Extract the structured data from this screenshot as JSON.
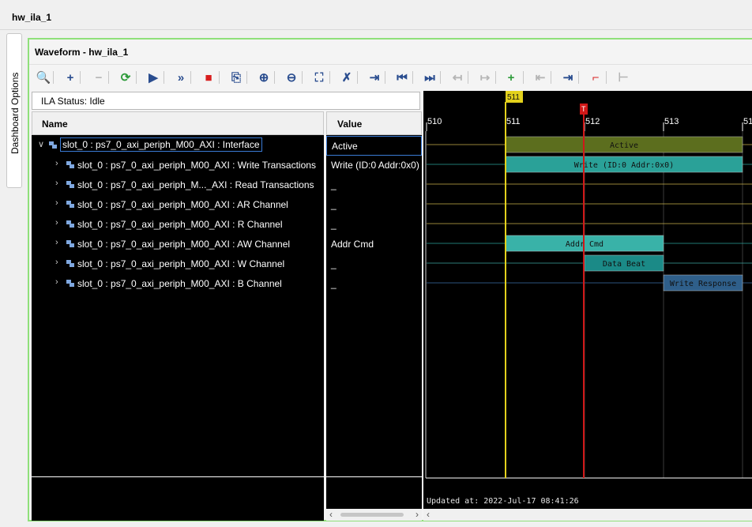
{
  "app": {
    "title": "hw_ila_1"
  },
  "side_tab": {
    "label": "Dashboard Options"
  },
  "panel": {
    "title": "Waveform - hw_ila_1"
  },
  "toolbar": {
    "buttons": [
      {
        "name": "zoom-search-icon",
        "glyph": "🔍",
        "enabled": true
      },
      {
        "name": "add-icon",
        "glyph": "+",
        "enabled": true
      },
      {
        "name": "remove-icon",
        "glyph": "−",
        "enabled": false
      },
      {
        "name": "auto-retrigger-icon",
        "glyph": "⟳",
        "enabled": true
      },
      {
        "name": "run-trigger-icon",
        "glyph": "▶",
        "enabled": true
      },
      {
        "name": "run-immediate-icon",
        "glyph": "»",
        "enabled": true
      },
      {
        "name": "stop-icon",
        "glyph": "■",
        "enabled": true
      },
      {
        "name": "export-icon",
        "glyph": "⎘",
        "enabled": true
      },
      {
        "name": "zoom-in-icon",
        "glyph": "⊕",
        "enabled": true
      },
      {
        "name": "zoom-out-icon",
        "glyph": "⊖",
        "enabled": true
      },
      {
        "name": "zoom-fit-icon",
        "glyph": "⛶",
        "enabled": true
      },
      {
        "name": "cursor-snap-icon",
        "glyph": "✗",
        "enabled": true
      },
      {
        "name": "go-to-cursor-icon",
        "glyph": "⇥",
        "enabled": true
      },
      {
        "name": "go-to-start-icon",
        "glyph": "⏮",
        "enabled": true
      },
      {
        "name": "go-to-end-icon",
        "glyph": "⏭",
        "enabled": true
      },
      {
        "name": "previous-transition-icon",
        "glyph": "↤",
        "enabled": false
      },
      {
        "name": "next-transition-icon",
        "glyph": "↦",
        "enabled": false
      },
      {
        "name": "add-marker-icon",
        "glyph": "+",
        "enabled": true
      },
      {
        "name": "previous-marker-icon",
        "glyph": "⇤",
        "enabled": false
      },
      {
        "name": "next-marker-icon",
        "glyph": "⇥",
        "enabled": true
      },
      {
        "name": "swap-cursors-icon",
        "glyph": "⌐",
        "enabled": true
      },
      {
        "name": "fit-cursors-icon",
        "glyph": "⊢",
        "enabled": false
      }
    ]
  },
  "status": {
    "text": "ILA Status: Idle"
  },
  "columns": {
    "name": "Name",
    "value": "Value"
  },
  "signals": [
    {
      "label": "slot_0 : ps7_0_axi_periph_M00_AXI : Interface",
      "value": "Active",
      "expanded": true,
      "indent": 0,
      "selected": true
    },
    {
      "label": "slot_0 : ps7_0_axi_periph_M00_AXI : Write Transactions",
      "value": "Write (ID:0 Addr:0x0)",
      "expanded": false,
      "indent": 1,
      "selected": false
    },
    {
      "label": "slot_0 : ps7_0_axi_periph_M..._AXI : Read Transactions",
      "value": "_",
      "expanded": false,
      "indent": 1,
      "selected": false
    },
    {
      "label": "slot_0 : ps7_0_axi_periph_M00_AXI : AR Channel",
      "value": "_",
      "expanded": false,
      "indent": 1,
      "selected": false
    },
    {
      "label": "slot_0 : ps7_0_axi_periph_M00_AXI : R Channel",
      "value": "_",
      "expanded": false,
      "indent": 1,
      "selected": false
    },
    {
      "label": "slot_0 : ps7_0_axi_periph_M00_AXI : AW Channel",
      "value": "Addr Cmd",
      "expanded": false,
      "indent": 1,
      "selected": false
    },
    {
      "label": "slot_0 : ps7_0_axi_periph_M00_AXI : W Channel",
      "value": "_",
      "expanded": false,
      "indent": 1,
      "selected": false
    },
    {
      "label": "slot_0 : ps7_0_axi_periph_M00_AXI : B Channel",
      "value": "_",
      "expanded": false,
      "indent": 1,
      "selected": false
    }
  ],
  "waveform": {
    "time_ticks": [
      "510",
      "511",
      "512",
      "513",
      "51"
    ],
    "marker_label": "511",
    "cursor_label": "T",
    "updated_text": "Updated at: 2022-Jul-17 08:41:26",
    "segments": [
      {
        "row": 0,
        "start": 511,
        "end": 514,
        "label": "Active",
        "color": "#5c6e1e"
      },
      {
        "row": 1,
        "start": 511,
        "end": 514,
        "label": "Write (ID:0 Addr:0x0)",
        "color": "#2aa198"
      },
      {
        "row": 5,
        "start": 511,
        "end": 513,
        "label": "Addr Cmd",
        "color": "#39b2a8"
      },
      {
        "row": 6,
        "start": 512,
        "end": 513,
        "label": "Data Beat",
        "color": "#1b8a87"
      },
      {
        "row": 7,
        "start": 513,
        "end": 514,
        "label": "Write Response",
        "color": "#2f5f8a"
      }
    ],
    "idle_line_colors": [
      "#c9b24a",
      "#2aa198",
      "#c9b24a",
      "#c9b24a",
      "#c9b24a",
      "#2aa198",
      "#3aa7a0",
      "#3d6ea8"
    ],
    "marker_time": 511,
    "cursor_time": 511.99,
    "colors": {
      "marker": "#e3d11c",
      "cursor": "#d01818"
    }
  }
}
